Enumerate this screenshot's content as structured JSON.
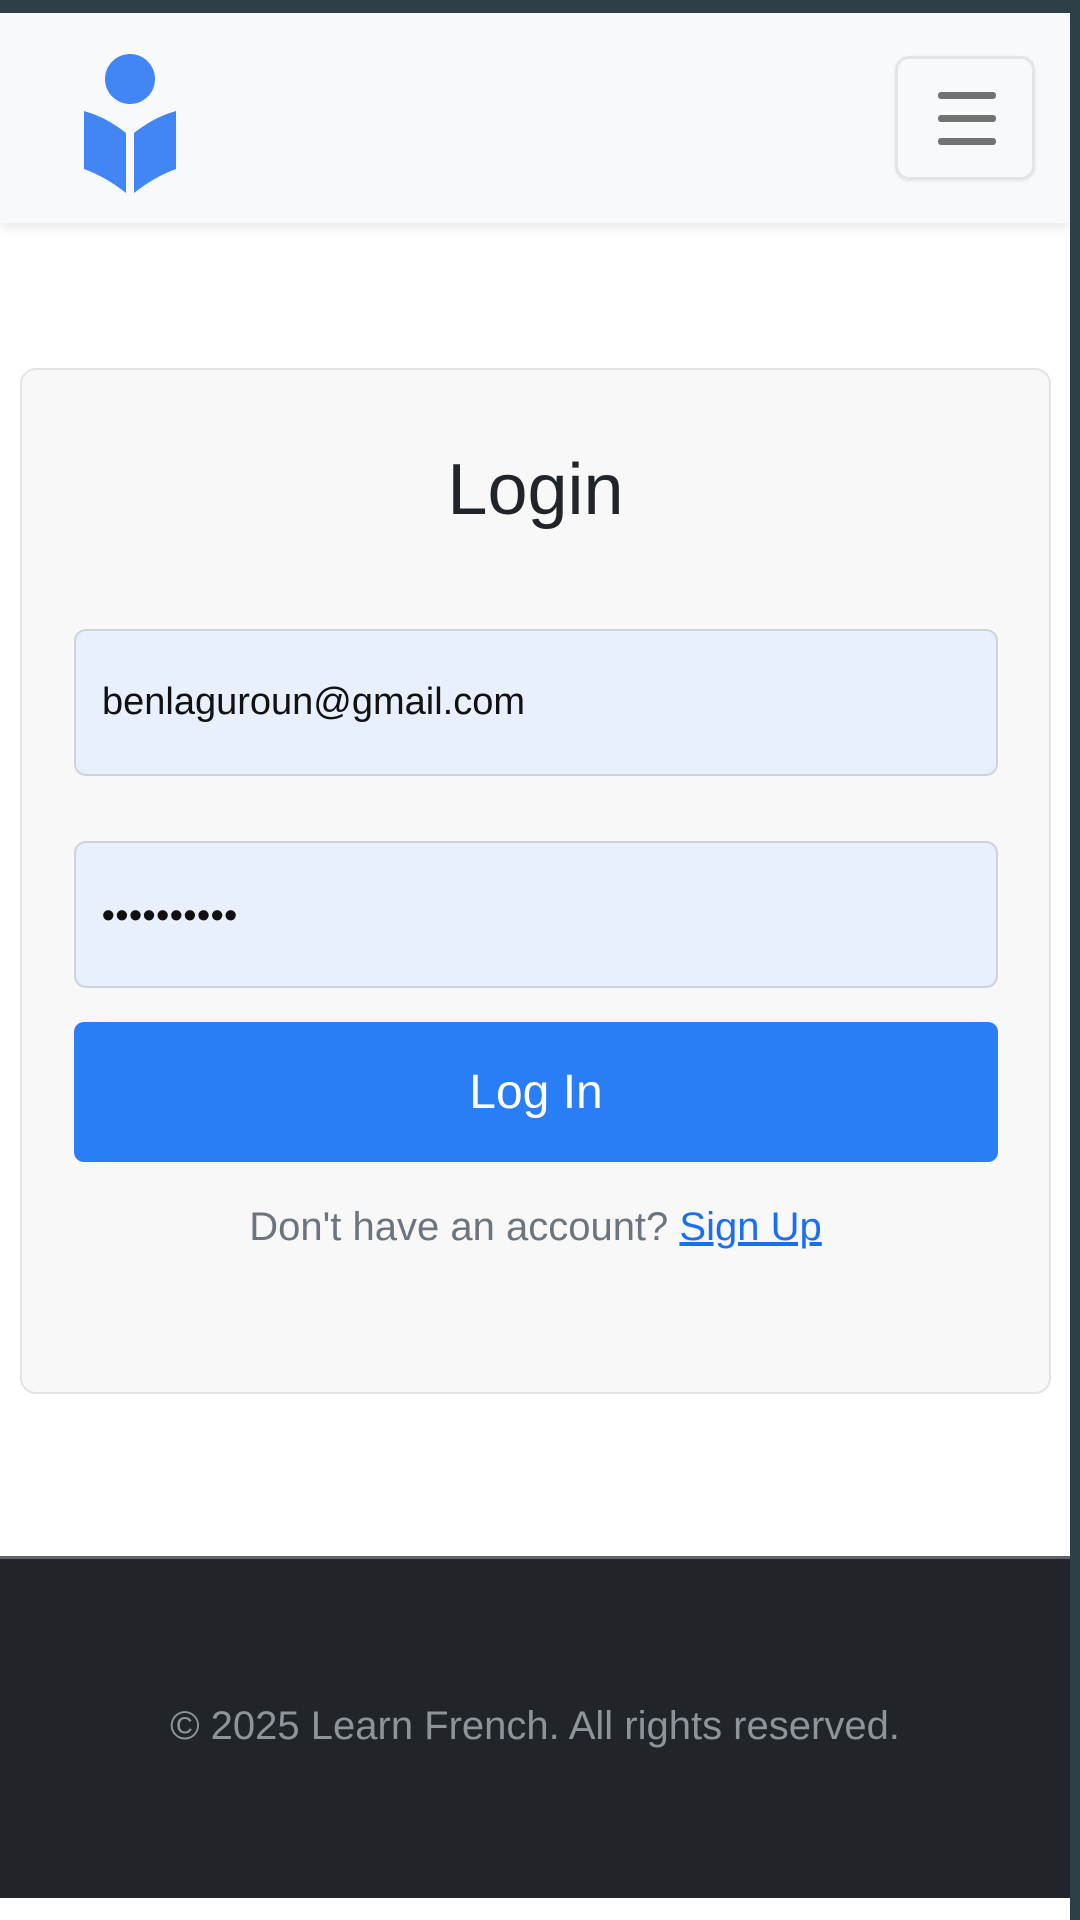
{
  "navbar": {
    "logo_icon": "book-reader-icon",
    "menu_icon": "hamburger-menu-icon",
    "brand_color": "#4285f4"
  },
  "login": {
    "title": "Login",
    "email_value": "benlaguroun@gmail.com",
    "password_value": "••••••••••",
    "submit_label": "Log In",
    "signup_prompt": "Don't have an account?",
    "signup_link": "Sign Up"
  },
  "footer": {
    "text": "© 2025 Learn French. All rights reserved."
  },
  "colors": {
    "primary_button": "#2a7ef5",
    "input_fill": "#e8f0fe",
    "footer_bg": "#212529",
    "link": "#1a6ff0"
  }
}
